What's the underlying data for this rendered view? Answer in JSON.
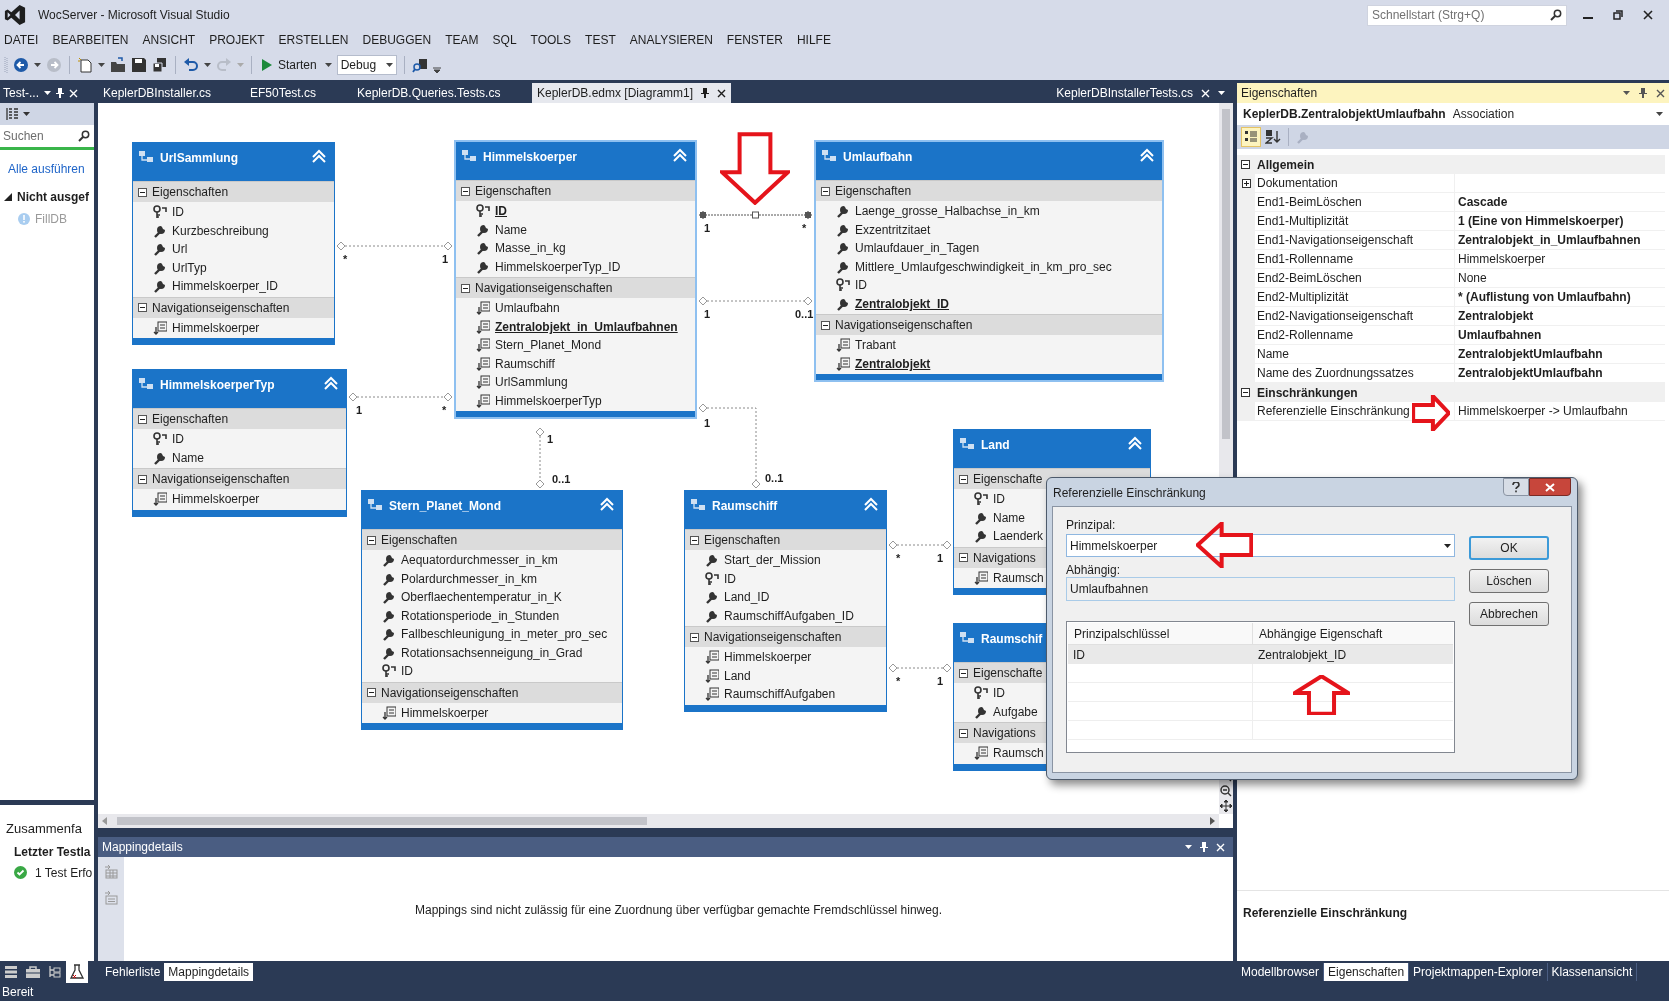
{
  "window": {
    "title": "WocServer - Microsoft Visual Studio",
    "quick_launch": {
      "placeholder": "Schnellstart (Strg+Q)"
    }
  },
  "menu": [
    "DATEI",
    "BEARBEITEN",
    "ANSICHT",
    "PROJEKT",
    "ERSTELLEN",
    "DEBUGGEN",
    "TEAM",
    "SQL",
    "TOOLS",
    "TEST",
    "ANALYSIEREN",
    "FENSTER",
    "HILFE"
  ],
  "toolbar": {
    "start_label": "Starten",
    "configuration": "Debug"
  },
  "left_panel": {
    "title": "Test-...",
    "search": {
      "placeholder": "Suchen"
    },
    "run_all": "Alle ausführen",
    "group": {
      "label": "Nicht ausgef",
      "expanded": true
    },
    "tests": [
      "FillDB"
    ],
    "summary": {
      "title": "Zusammenfa",
      "last_run": "Letzter Testla",
      "result": "1 Test Erfo"
    },
    "tool_tabs": [
      {
        "kind": "servers",
        "selected": false
      },
      {
        "kind": "toolbox",
        "selected": false
      },
      {
        "kind": "tree",
        "selected": false
      },
      {
        "kind": "tests",
        "selected": true
      }
    ]
  },
  "document_tabs": [
    {
      "label": "KeplerDBInstaller.cs",
      "selected": false
    },
    {
      "label": "EF50Test.cs",
      "selected": false
    },
    {
      "label": "KeplerDB.Queries.Tests.cs",
      "selected": false
    },
    {
      "label": "KeplerDB.edmx [Diagramm1]",
      "selected": true
    }
  ],
  "overflow_tab": {
    "label": "KeplerDBInstallerTests.cs"
  },
  "diagram": {
    "entities": [
      {
        "title": "UrlSammlung",
        "selected": false,
        "header_button": true,
        "sections": [
          {
            "title": "Eigenschaften",
            "expanded": true,
            "items": [
              {
                "text": "ID",
                "kind": "key",
                "highlighted": false
              },
              {
                "text": "Kurzbeschreibung",
                "kind": "property",
                "highlighted": false
              },
              {
                "text": "Url",
                "kind": "property",
                "highlighted": false
              },
              {
                "text": "UrlTyp",
                "kind": "property",
                "highlighted": false
              },
              {
                "text": "Himmelskoerper_ID",
                "kind": "property",
                "highlighted": false
              }
            ]
          },
          {
            "title": "Navigationseigenschaften",
            "expanded": true,
            "items": [
              {
                "text": "Himmelskoerper",
                "kind": "navigation",
                "highlighted": false
              }
            ]
          }
        ]
      },
      {
        "title": "Himmelskoerper",
        "selected": true,
        "header_button": true,
        "sections": [
          {
            "title": "Eigenschaften",
            "expanded": true,
            "items": [
              {
                "text": "ID",
                "kind": "key",
                "highlighted": true
              },
              {
                "text": "Name",
                "kind": "property",
                "highlighted": false
              },
              {
                "text": "Masse_in_kg",
                "kind": "property",
                "highlighted": false
              },
              {
                "text": "HimmelskoerperTyp_ID",
                "kind": "property",
                "highlighted": false
              }
            ]
          },
          {
            "title": "Navigationseigenschaften",
            "expanded": true,
            "items": [
              {
                "text": "Umlaufbahn",
                "kind": "navigation",
                "highlighted": false
              },
              {
                "text": "Zentralobjekt_in_Umlaufbahnen",
                "kind": "navigation",
                "highlighted": true
              },
              {
                "text": "Stern_Planet_Mond",
                "kind": "navigation",
                "highlighted": false
              },
              {
                "text": "Raumschiff",
                "kind": "navigation",
                "highlighted": false
              },
              {
                "text": "UrlSammlung",
                "kind": "navigation",
                "highlighted": false
              },
              {
                "text": "HimmelskoerperTyp",
                "kind": "navigation",
                "highlighted": false
              }
            ]
          }
        ]
      },
      {
        "title": "Umlaufbahn",
        "selected": true,
        "header_button": true,
        "sections": [
          {
            "title": "Eigenschaften",
            "expanded": true,
            "items": [
              {
                "text": "Laenge_grosse_Halbachse_in_km",
                "kind": "property",
                "highlighted": false
              },
              {
                "text": "Exzentritzitaet",
                "kind": "property",
                "highlighted": false
              },
              {
                "text": "Umlaufdauer_in_Tagen",
                "kind": "property",
                "highlighted": false
              },
              {
                "text": "Mittlere_Umlaufgeschwindigkeit_in_km_pro_sec",
                "kind": "property",
                "highlighted": false
              },
              {
                "text": "ID",
                "kind": "key",
                "highlighted": false
              },
              {
                "text": "Zentralobjekt_ID",
                "kind": "property",
                "highlighted": true
              }
            ]
          },
          {
            "title": "Navigationseigenschaften",
            "expanded": true,
            "items": [
              {
                "text": "Trabant",
                "kind": "navigation",
                "highlighted": false
              },
              {
                "text": "Zentralobjekt",
                "kind": "navigation",
                "highlighted": true
              }
            ]
          }
        ]
      },
      {
        "title": "HimmelskoerperTyp",
        "selected": false,
        "header_button": true,
        "sections": [
          {
            "title": "Eigenschaften",
            "expanded": true,
            "items": [
              {
                "text": "ID",
                "kind": "key",
                "highlighted": false
              },
              {
                "text": "Name",
                "kind": "property",
                "highlighted": false
              }
            ]
          },
          {
            "title": "Navigationseigenschaften",
            "expanded": true,
            "items": [
              {
                "text": "Himmelskoerper",
                "kind": "navigation",
                "highlighted": false
              }
            ]
          }
        ]
      },
      {
        "title": "Stern_Planet_Mond",
        "selected": false,
        "header_button": true,
        "sections": [
          {
            "title": "Eigenschaften",
            "expanded": true,
            "items": [
              {
                "text": "Aequatordurchmesser_in_km",
                "kind": "property",
                "highlighted": false
              },
              {
                "text": "Polardurchmesser_in_km",
                "kind": "property",
                "highlighted": false
              },
              {
                "text": "Oberflaechentemperatur_in_K",
                "kind": "property",
                "highlighted": false
              },
              {
                "text": "Rotationsperiode_in_Stunden",
                "kind": "property",
                "highlighted": false
              },
              {
                "text": "Fallbeschleunigung_in_meter_pro_sec",
                "kind": "property",
                "highlighted": false
              },
              {
                "text": "Rotationsachsenneigung_in_Grad",
                "kind": "property",
                "highlighted": false
              },
              {
                "text": "ID",
                "kind": "key",
                "highlighted": false
              }
            ]
          },
          {
            "title": "Navigationseigenschaften",
            "expanded": true,
            "items": [
              {
                "text": "Himmelskoerper",
                "kind": "navigation",
                "highlighted": false
              }
            ]
          }
        ]
      },
      {
        "title": "Raumschiff",
        "selected": false,
        "header_button": true,
        "sections": [
          {
            "title": "Eigenschaften",
            "expanded": true,
            "items": [
              {
                "text": "Start_der_Mission",
                "kind": "property",
                "highlighted": false
              },
              {
                "text": "ID",
                "kind": "key",
                "highlighted": false
              },
              {
                "text": "Land_ID",
                "kind": "property",
                "highlighted": false
              },
              {
                "text": "RaumschiffAufgaben_ID",
                "kind": "property",
                "highlighted": false
              }
            ]
          },
          {
            "title": "Navigationseigenschaften",
            "expanded": true,
            "items": [
              {
                "text": "Himmelskoerper",
                "kind": "navigation",
                "highlighted": false
              },
              {
                "text": "Land",
                "kind": "navigation",
                "highlighted": false
              },
              {
                "text": "RaumschiffAufgaben",
                "kind": "navigation",
                "highlighted": false
              }
            ]
          }
        ]
      },
      {
        "title": "Land",
        "selected": false,
        "header_button": true,
        "sections": [
          {
            "title": "Eigenschafte",
            "expanded": true,
            "items": [
              {
                "text": "ID",
                "kind": "key",
                "highlighted": false
              },
              {
                "text": "Name",
                "kind": "property",
                "highlighted": false
              },
              {
                "text": "Laenderk",
                "kind": "property",
                "highlighted": false
              }
            ]
          },
          {
            "title": "Navigations",
            "expanded": true,
            "items": [
              {
                "text": "Raumsch",
                "kind": "navigation",
                "highlighted": false
              }
            ]
          }
        ]
      },
      {
        "title": "Raumschif",
        "selected": false,
        "header_button": false,
        "sections": [
          {
            "title": "Eigenschafte",
            "expanded": true,
            "items": [
              {
                "text": "ID",
                "kind": "key",
                "highlighted": false
              },
              {
                "text": "Aufgabe",
                "kind": "property",
                "highlighted": false
              }
            ]
          },
          {
            "title": "Navigations",
            "expanded": true,
            "items": [
              {
                "text": "Raumsch",
                "kind": "navigation",
                "highlighted": false
              }
            ]
          }
        ]
      }
    ],
    "associations": [
      {
        "end1": "*",
        "end2": "1",
        "selected": false
      },
      {
        "end1": "1",
        "end2": "*",
        "selected": false
      },
      {
        "end1": "1",
        "end2": "*",
        "selected": true
      },
      {
        "end1": "1",
        "end2": "0..1",
        "selected": false
      },
      {
        "end1": "1",
        "end2": "0..1",
        "selected": false
      },
      {
        "end1": "1",
        "end2": "0..1",
        "selected": false
      },
      {
        "end1": "*",
        "end2": "1",
        "selected": false
      },
      {
        "end1": "*",
        "end2": "1",
        "selected": false
      }
    ]
  },
  "mapping_details": {
    "title": "Mappingdetails",
    "message": "Mappings sind nicht zulässig für eine Zuordnung über verfügbar gemachte Fremdschlüssel hinweg."
  },
  "bottom_tabs": [
    {
      "label": "Fehlerliste",
      "selected": false
    },
    {
      "label": "Mappingdetails",
      "selected": true
    }
  ],
  "properties": {
    "title": "Eigenschaften",
    "object_name": "KeplerDB.ZentralobjektUmlaufbahn",
    "object_type": "Association",
    "rows": [
      {
        "kind": "category",
        "label": "Allgemein",
        "expanded": true
      },
      {
        "kind": "property",
        "label": "Dokumentation",
        "expanded": false
      },
      {
        "kind": "property",
        "label": "End1-BeimLöschen",
        "value": "Cascade",
        "modified": true
      },
      {
        "kind": "property",
        "label": "End1-Multiplizität",
        "value": "1 (Eine von Himmelskoerper)",
        "modified": true
      },
      {
        "kind": "property",
        "label": "End1-Navigationseigenschaft",
        "value": "Zentralobjekt_in_Umlaufbahnen",
        "modified": true
      },
      {
        "kind": "property",
        "label": "End1-Rollenname",
        "value": "Himmelskoerper",
        "modified": false
      },
      {
        "kind": "property",
        "label": "End2-BeimLöschen",
        "value": "None",
        "modified": false
      },
      {
        "kind": "property",
        "label": "End2-Multiplizität",
        "value": "* (Auflistung von Umlaufbahn)",
        "modified": true
      },
      {
        "kind": "property",
        "label": "End2-Navigationseigenschaft",
        "value": "Zentralobjekt",
        "modified": true
      },
      {
        "kind": "property",
        "label": "End2-Rollenname",
        "value": "Umlaufbahnen",
        "modified": true
      },
      {
        "kind": "property",
        "label": "Name",
        "value": "ZentralobjektUmlaufbahn",
        "modified": true
      },
      {
        "kind": "property",
        "label": "Name des Zuordnungssatzes",
        "value": "ZentralobjektUmlaufbahn",
        "modified": true
      },
      {
        "kind": "category",
        "label": "Einschränkungen",
        "expanded": true
      },
      {
        "kind": "property",
        "label": "Referenzielle Einschränkung",
        "value": "Himmelskoerper -> Umlaufbahn",
        "modified": false
      }
    ],
    "description_title": "Referenzielle Einschränkung"
  },
  "right_tabs": [
    {
      "label": "Modellbrowser",
      "selected": false
    },
    {
      "label": "Eigenschaften",
      "selected": true
    },
    {
      "label": "Projektmappen-Explorer",
      "selected": false
    },
    {
      "label": "Klassenansicht",
      "selected": false
    }
  ],
  "dialog": {
    "title": "Referenzielle Einschränkung",
    "principal_label": "Prinzipal:",
    "principal": "Himmelskoerper",
    "dependent_label": "Abhängig:",
    "dependent": "Umlaufbahnen",
    "columns": [
      "Prinzipalschlüssel",
      "Abhängige Eigenschaft"
    ],
    "rows": [
      [
        "ID",
        "Zentralobjekt_ID"
      ]
    ],
    "buttons": [
      {
        "label": "OK",
        "default": true
      },
      {
        "label": "Löschen",
        "default": false
      },
      {
        "label": "Abbrechen",
        "default": false
      }
    ]
  },
  "annotations": [
    {
      "kind": "down"
    },
    {
      "kind": "right"
    },
    {
      "kind": "left"
    },
    {
      "kind": "up"
    }
  ],
  "status_bar": "Bereit"
}
